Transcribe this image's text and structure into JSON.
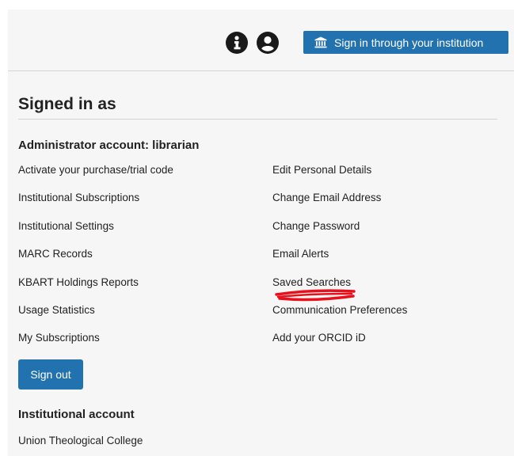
{
  "header": {
    "signin_button_label": "Sign in through your institution",
    "icons": [
      "info-icon",
      "user-account-icon",
      "institution-icon"
    ]
  },
  "account": {
    "title": "Signed in as",
    "admin_heading": "Administrator account: librarian",
    "left_links": [
      "Activate your purchase/trial code",
      "Institutional Subscriptions",
      "Institutional Settings",
      "MARC Records",
      "KBART Holdings Reports",
      "Usage Statistics",
      "My Subscriptions"
    ],
    "right_links": [
      "Edit Personal Details",
      "Change Email Address",
      "Change Password",
      "Email Alerts",
      "Saved Searches",
      "Communication Preferences",
      "Add your ORCID iD"
    ],
    "signout_label": "Sign out",
    "institutional_heading": "Institutional account",
    "institution_name": "Union Theological College"
  },
  "colors": {
    "primary_button": "#2372b0",
    "panel_background": "#f6f6f6",
    "annotation": "#e8101a"
  }
}
